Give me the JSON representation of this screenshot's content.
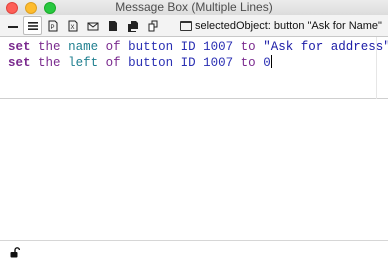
{
  "window": {
    "title": "Message Box (Multiple Lines)"
  },
  "toolbar": {
    "tools": [
      {
        "name": "single-line-icon",
        "active": false
      },
      {
        "name": "multiple-lines-icon",
        "active": true
      },
      {
        "name": "global-properties-icon",
        "active": false
      },
      {
        "name": "global-variables-icon",
        "active": false
      },
      {
        "name": "pending-messages-icon",
        "active": false
      },
      {
        "name": "front-scripts-icon",
        "active": false
      },
      {
        "name": "back-scripts-icon",
        "active": false
      },
      {
        "name": "stacks-in-use-icon",
        "active": false
      }
    ],
    "selected_object": "selectedObject: button \"Ask for Name\""
  },
  "editor": {
    "lines": [
      {
        "k1": "set",
        "k2": "the",
        "prop": "name",
        "of": "of",
        "obj": "button ID 1007",
        "to": "to",
        "val": "\"Ask for address\""
      },
      {
        "k1": "set",
        "k2": "the",
        "prop": "left",
        "of": "of",
        "obj": "button ID 1007",
        "to": "to",
        "val": "0"
      }
    ]
  },
  "status": {
    "lock_icon": "unlocked-padlock-icon"
  }
}
